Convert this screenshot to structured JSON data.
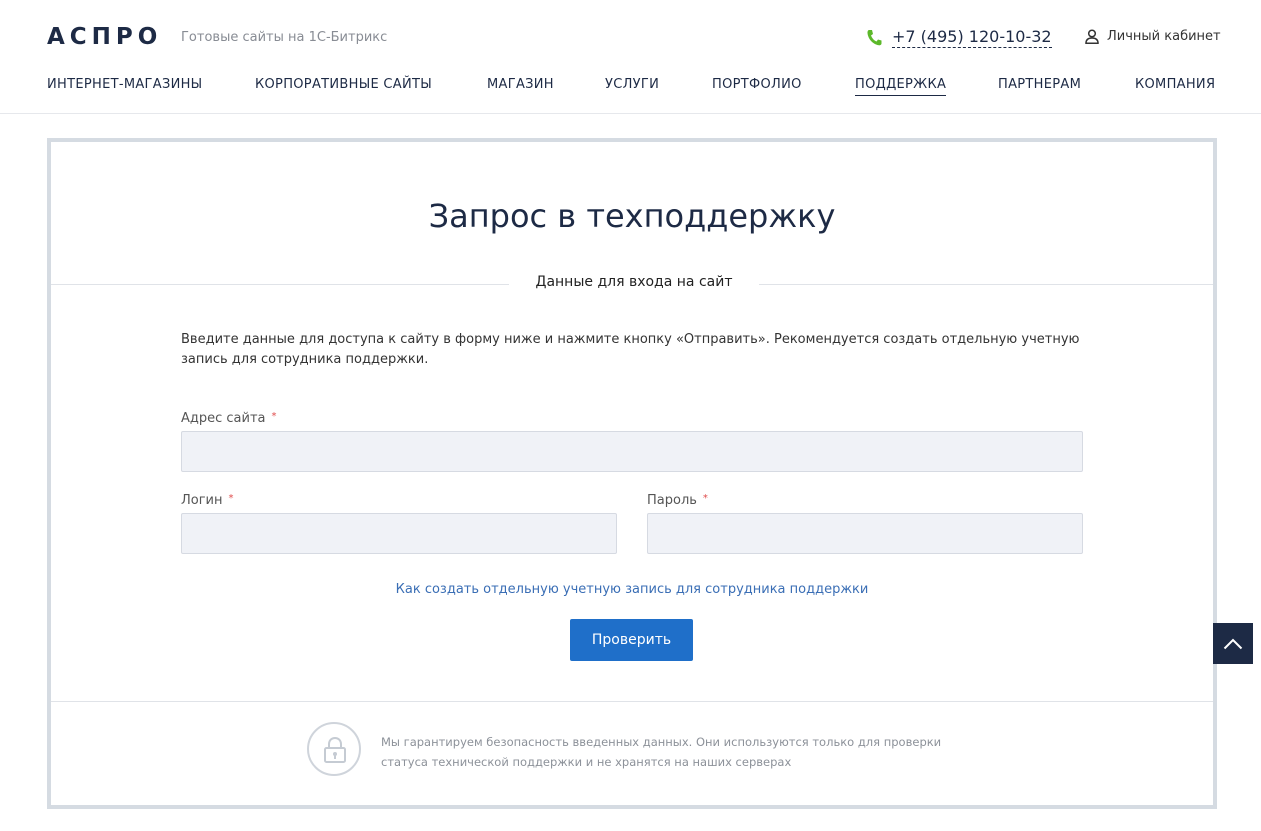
{
  "header": {
    "logo": "АСПРО",
    "tagline": "Готовые сайты на 1С-Битрикс",
    "phone": "+7 (495) 120-10-32",
    "cabinet": "Личный кабинет"
  },
  "nav": {
    "items": [
      {
        "label": "ИНТЕРНЕТ-МАГАЗИНЫ"
      },
      {
        "label": "КОРПОРАТИВНЫЕ САЙТЫ"
      },
      {
        "label": "МАГАЗИН"
      },
      {
        "label": "УСЛУГИ"
      },
      {
        "label": "ПОРТФОЛИО"
      },
      {
        "label": "ПОДДЕРЖКА",
        "active": true
      },
      {
        "label": "ПАРТНЕРАМ"
      },
      {
        "label": "КОМПАНИЯ"
      }
    ]
  },
  "form": {
    "title": "Запрос в техподдержку",
    "section_label": "Данные для входа на сайт",
    "intro": "Введите данные для доступа к сайту в форму ниже и нажмите кнопку «Отправить». Рекомендуется создать отдельную учетную запись для сотрудника поддержки.",
    "fields": {
      "site": {
        "label": "Адрес сайта",
        "value": ""
      },
      "login": {
        "label": "Логин",
        "value": ""
      },
      "password": {
        "label": "Пароль",
        "value": ""
      }
    },
    "required_mark": "*",
    "help_link": "Как создать отдельную учетную запись для сотрудника поддержки",
    "submit": "Проверить",
    "security_line1": "Мы гарантируем безопасность введенных данных. Они используются только для проверки",
    "security_line2": "статуса технической поддержки и не хранятся на наших серверах"
  },
  "colors": {
    "brand_dark": "#1d2a45",
    "button_blue": "#1f6fc9",
    "link_blue": "#3a6eb5",
    "phone_green": "#5cb82a",
    "required_red": "#e04c4c"
  },
  "icons": {
    "phone": "phone-icon",
    "user": "user-icon",
    "lock": "lock-icon",
    "scroll_top": "chevron-up-icon"
  }
}
